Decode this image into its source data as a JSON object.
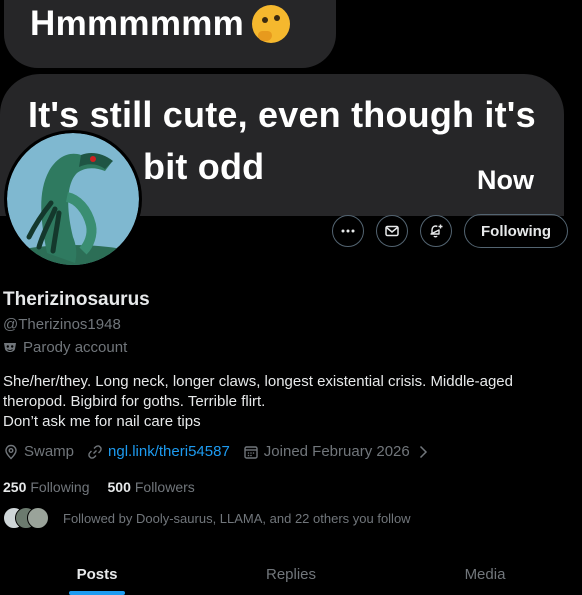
{
  "banner": {
    "bubble1_text": "Hmmmmmm",
    "bubble1_emoji": "thinking-face-icon",
    "bubble2_line1": "It's still cute, even though it's",
    "bubble2_line2": "bit odd",
    "bubble2_timestamp": "Now"
  },
  "profile": {
    "display_name": "Therizinosaurus",
    "handle": "@Therizinos1948",
    "parody_label": "Parody account",
    "bio_lines": [
      "She/her/they. Long neck, longer claws, longest existential crisis. Middle-aged",
      "theropod. Bigbird for goths. Terrible flirt.",
      "Don’t ask me for nail care tips"
    ],
    "location": "Swamp",
    "link": "ngl.link/theri54587",
    "joined": "Joined February 2026",
    "following_count": "250",
    "following_label": "Following",
    "followers_count": "500",
    "followers_label": "Followers",
    "followed_by": "Followed by Dooly-saurus, LLAMA, and 22 others you follow"
  },
  "actions": {
    "more_icon": "more-icon",
    "message_icon": "mail-icon",
    "notify_icon": "bell-plus-icon",
    "follow_label": "Following"
  },
  "tabs": [
    "Posts",
    "Replies",
    "Media"
  ],
  "colors": {
    "background": "#000000",
    "accent": "#1d9bf0",
    "muted": "#71767b",
    "bubble": "#262628"
  }
}
